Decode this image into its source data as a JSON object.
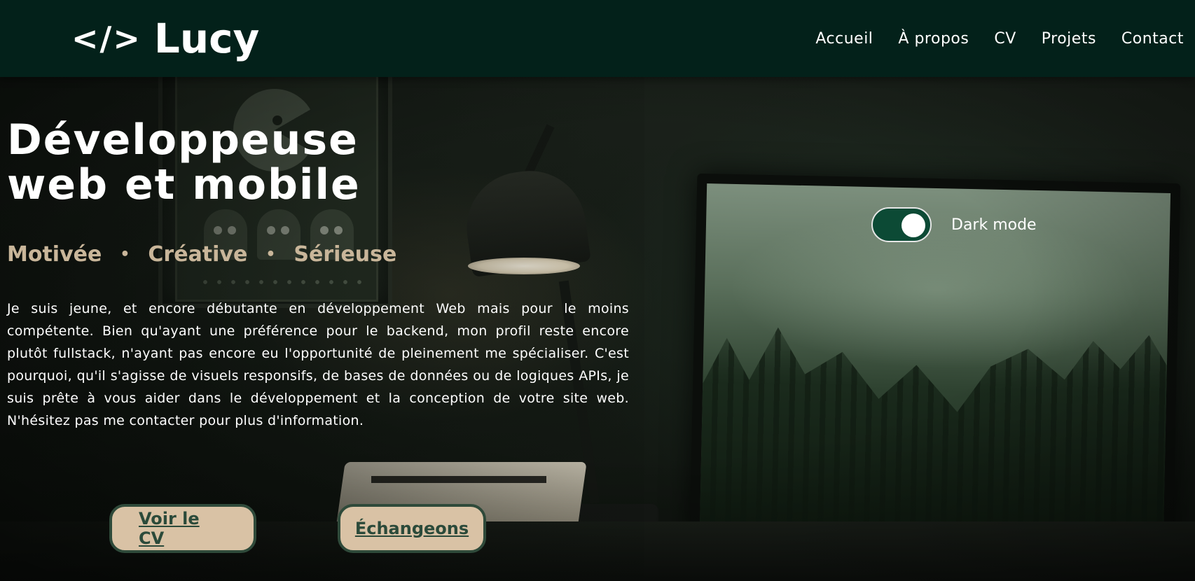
{
  "header": {
    "logo_code": "</>",
    "logo_name": "Lucy",
    "nav": [
      {
        "label": "Accueil"
      },
      {
        "label": "À propos"
      },
      {
        "label": "CV"
      },
      {
        "label": "Projets"
      },
      {
        "label": "Contact"
      }
    ]
  },
  "hero": {
    "title": "Développeuse\nweb et mobile",
    "qualities": [
      "Motivée",
      "Créative",
      "Sérieuse"
    ],
    "separator": "•",
    "intro": "Je suis jeune, et encore débutante en développement Web mais pour le moins compétente. Bien qu'ayant une préférence pour le backend, mon profil reste encore plutôt fullstack, n'ayant pas encore eu l'opportunité de pleinement me spécialiser. C'est pourquoi, qu'il s'agisse de visuels responsifs, de bases de données ou de logiques APIs, je suis prête à vous aider dans le développement et la conception de votre site web. N'hésitez pas me contacter pour plus d'information.",
    "buttons": {
      "cv": "Voir le CV",
      "contact": "Échangeons"
    }
  },
  "theme_toggle": {
    "label": "Dark mode",
    "enabled": true
  },
  "colors": {
    "header_bg": "#03211a",
    "accent_beige": "#d9c2a5",
    "accent_green": "#0c4a35",
    "qualities_text": "#c9b69a"
  }
}
